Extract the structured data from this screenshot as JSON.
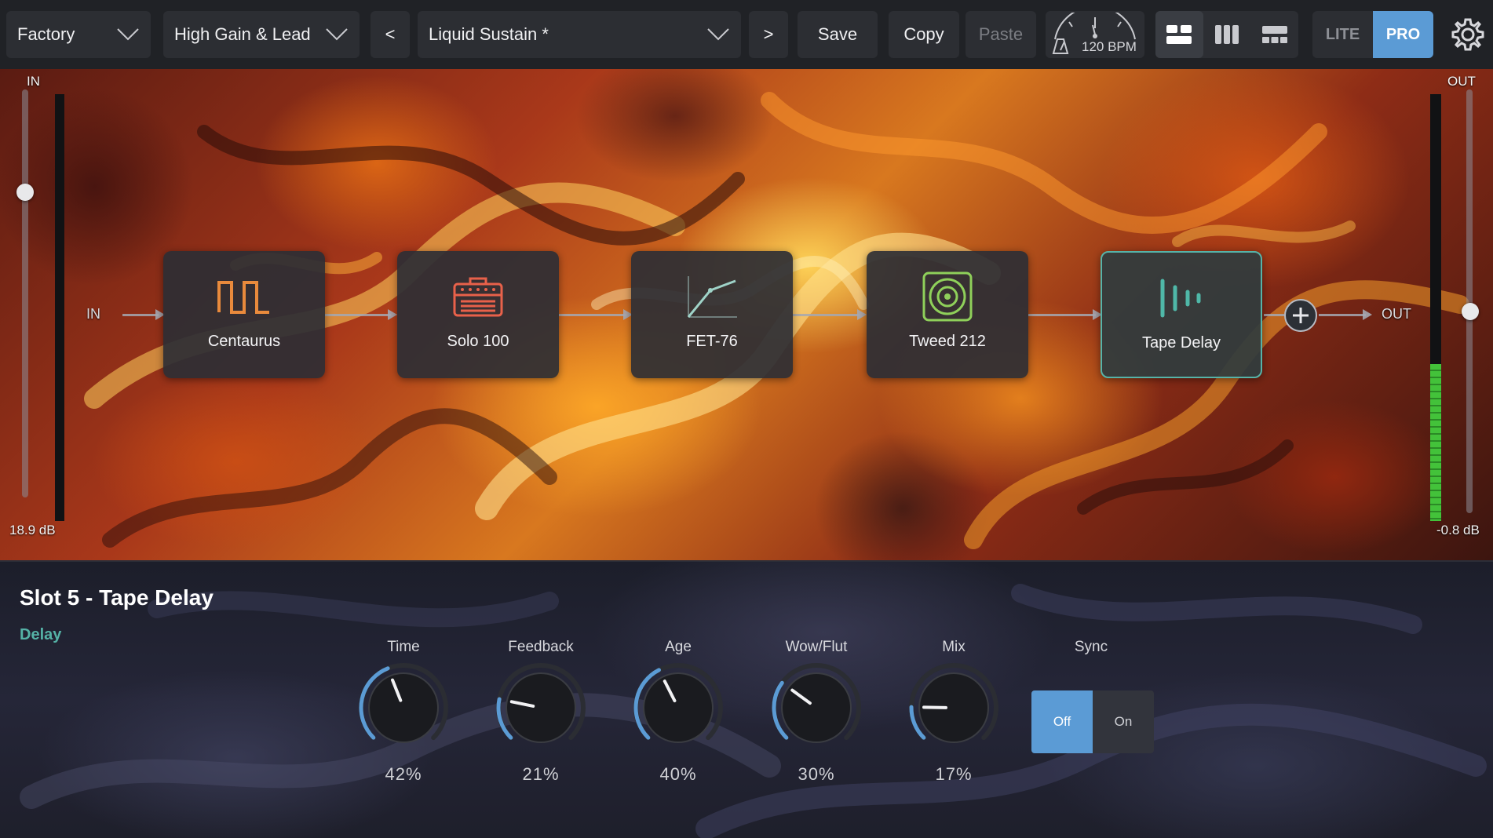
{
  "toolbar": {
    "bank": "Factory",
    "category": "High Gain & Lead",
    "prev_label": "<",
    "preset": "Liquid Sustain *",
    "next_label": ">",
    "save_label": "Save",
    "copy_label": "Copy",
    "paste_label": "Paste",
    "tempo": "120 BPM",
    "mode_lite": "LITE",
    "mode_pro": "PRO",
    "active_mode": "PRO"
  },
  "meters": {
    "in_label": "IN",
    "out_label": "OUT",
    "in_level": "18.9 dB",
    "out_level": "-0.8 dB"
  },
  "chain": {
    "in_label": "IN",
    "out_label": "OUT",
    "slots": [
      {
        "name": "Centaurus",
        "icon": "square-wave-icon",
        "color": "#e98a3c"
      },
      {
        "name": "Solo 100",
        "icon": "amp-head-icon",
        "color": "#e8614a"
      },
      {
        "name": "FET-76",
        "icon": "compressor-curve-icon",
        "color": "#9fd3c8"
      },
      {
        "name": "Tweed 212",
        "icon": "speaker-icon",
        "color": "#8fd05a"
      },
      {
        "name": "Tape Delay",
        "icon": "delay-taps-icon",
        "color": "#4fb8a8"
      }
    ],
    "selected_slot": 5
  },
  "editor": {
    "title": "Slot 5 - Tape Delay",
    "category": "Delay",
    "knobs": [
      {
        "label": "Time",
        "value": "42%",
        "level": 0.42
      },
      {
        "label": "Feedback",
        "value": "21%",
        "level": 0.21
      },
      {
        "label": "Age",
        "value": "40%",
        "level": 0.4
      },
      {
        "label": "Wow/Flut",
        "value": "30%",
        "level": 0.3
      },
      {
        "label": "Mix",
        "value": "17%",
        "level": 0.17
      }
    ],
    "sync": {
      "label": "Sync",
      "off": "Off",
      "on": "On",
      "state": "Off"
    }
  },
  "colors": {
    "accent_blue": "#5b9bd5",
    "accent_teal": "#55b2a6",
    "meter_green": "#43c23a"
  }
}
